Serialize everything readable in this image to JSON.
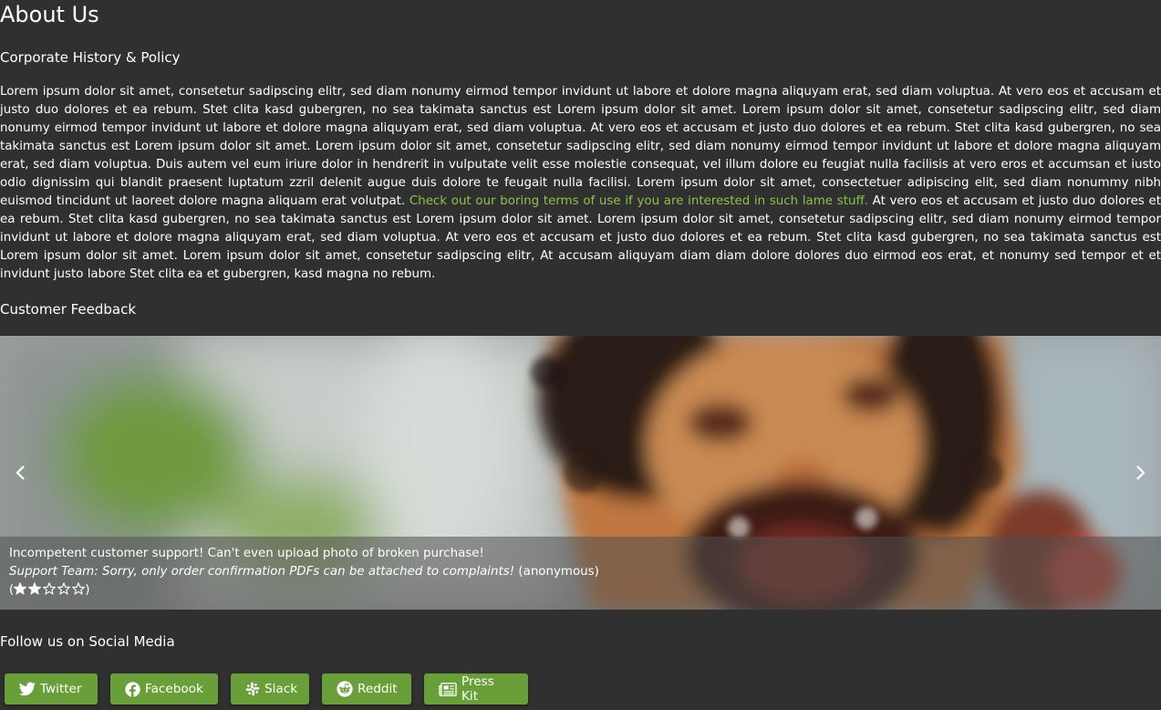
{
  "page": {
    "title": "About Us",
    "history_heading": "Corporate History & Policy",
    "paragraph_part1": "Lorem ipsum dolor sit amet, consetetur sadipscing elitr, sed diam nonumy eirmod tempor invidunt ut labore et dolore magna aliquyam erat, sed diam voluptua. At vero eos et accusam et justo duo dolores et ea rebum. Stet clita kasd gubergren, no sea takimata sanctus est Lorem ipsum dolor sit amet. Lorem ipsum dolor sit amet, consetetur sadipscing elitr, sed diam nonumy eirmod tempor invidunt ut labore et dolore magna aliquyam erat, sed diam voluptua. At vero eos et accusam et justo duo dolores et ea rebum. Stet clita kasd gubergren, no sea takimata sanctus est Lorem ipsum dolor sit amet. Lorem ipsum dolor sit amet, consetetur sadipscing elitr, sed diam nonumy eirmod tempor invidunt ut labore et dolore magna aliquyam erat, sed diam voluptua. Duis autem vel eum iriure dolor in hendrerit in vulputate velit esse molestie consequat, vel illum dolore eu feugiat nulla facilisis at vero eros et accumsan et iusto odio dignissim qui blandit praesent luptatum zzril delenit augue duis dolore te feugait nulla facilisi. Lorem ipsum dolor sit amet, consectetuer adipiscing elit, sed diam nonummy nibh euismod tincidunt ut laoreet dolore magna aliquam erat volutpat.",
    "terms_link": "Check out our boring terms of use if you are interested in such lame stuff.",
    "paragraph_part2": "At vero eos et accusam et justo duo dolores et ea rebum. Stet clita kasd gubergren, no sea takimata sanctus est Lorem ipsum dolor sit amet. Lorem ipsum dolor sit amet, consetetur sadipscing elitr, sed diam nonumy eirmod tempor invidunt ut labore et dolore magna aliquyam erat, sed diam voluptua. At vero eos et accusam et justo duo dolores et ea rebum. Stet clita kasd gubergren, no sea takimata sanctus est Lorem ipsum dolor sit amet. Lorem ipsum dolor sit amet, consetetur sadipscing elitr, At accusam aliquyam diam diam dolore dolores duo eirmod eos erat, et nonumy sed tempor et et invidunt justo labore Stet clita ea et gubergren, kasd magna no rebum.",
    "feedback_heading": "Customer Feedback",
    "social_heading": "Follow us on Social Media"
  },
  "feedback": {
    "comment": "Incompetent customer support! Can't even upload photo of broken purchase!",
    "reply": "Support Team: Sorry, only order confirmation PDFs can be attached to complaints!",
    "author": "(anonymous)",
    "rating_open": "(",
    "rating_close": ")",
    "rating": 2,
    "rating_max": 5
  },
  "social": {
    "twitter": "Twitter",
    "facebook": "Facebook",
    "slack": "Slack",
    "reddit": "Reddit",
    "press_kit": "Press Kit"
  },
  "colors": {
    "background": "#303030",
    "accent": "#689f38",
    "link": "#8bc34a"
  },
  "icons": {
    "prev": "chevron-left-icon",
    "next": "chevron-right-icon",
    "twitter": "twitter-icon",
    "facebook": "facebook-icon",
    "slack": "slack-icon",
    "reddit": "reddit-icon",
    "press_kit": "newspaper-icon"
  }
}
